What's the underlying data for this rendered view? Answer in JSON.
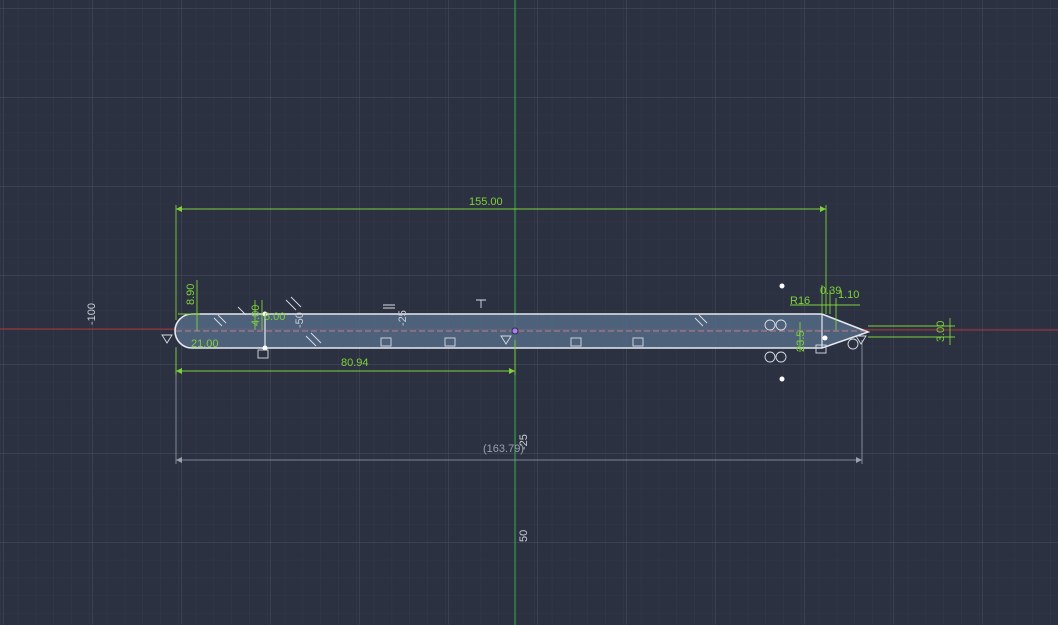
{
  "viewport": {
    "axis_labels": {
      "left": "-100",
      "center": "-25",
      "lower": "-25",
      "bottom": "50",
      "mid_left": "-50"
    }
  },
  "sketch": {
    "dimensions": {
      "overall_length": "155.00",
      "partial_length": "80.94",
      "reference_length": "(163.79)",
      "left_height": "8.90",
      "left_offset": "21.00",
      "left_small": "4.00",
      "left_small2": "6.00",
      "right_small": "0.39",
      "right_small2": "1.10",
      "radius": "R16",
      "right_vertical": "23.5",
      "right_height": "3.00"
    },
    "colors": {
      "grid_major": "#4a5162",
      "grid_minor": "#394050",
      "x_axis": "#b3383a",
      "y_axis": "#35b04a",
      "profile": "#e6e9ee",
      "fill": "#556a86",
      "dimension": "#7fd13b",
      "reference": "#9aa1ad"
    }
  }
}
